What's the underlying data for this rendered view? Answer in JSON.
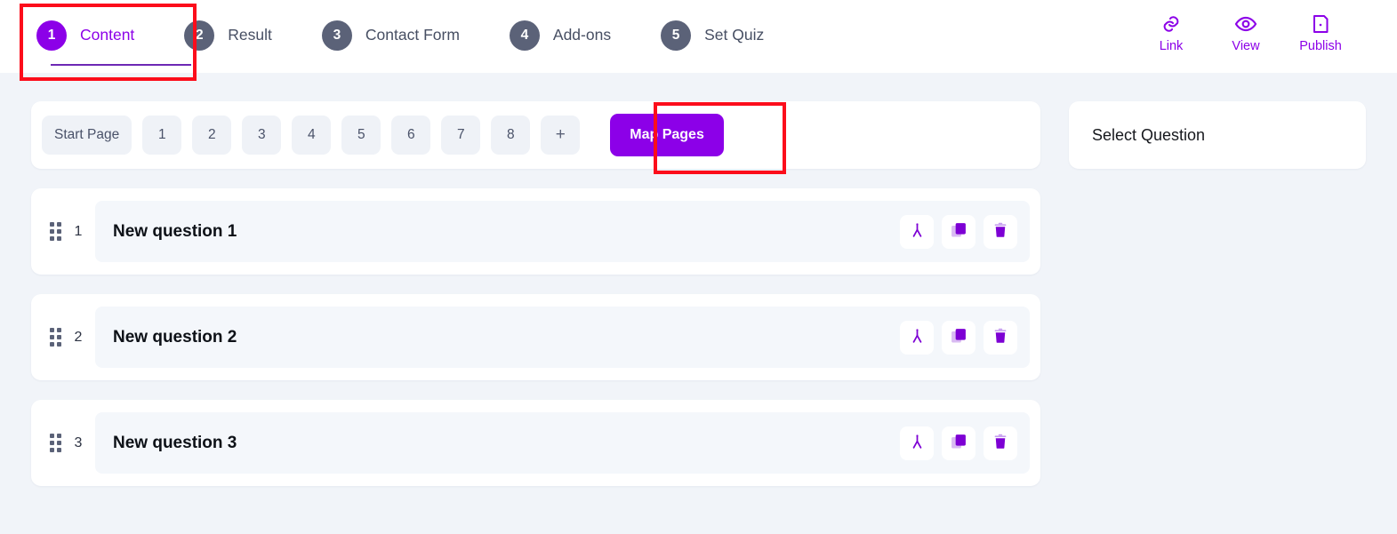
{
  "header": {
    "steps": [
      {
        "num": "1",
        "label": "Content",
        "active": true
      },
      {
        "num": "2",
        "label": "Result",
        "active": false
      },
      {
        "num": "3",
        "label": "Contact Form",
        "active": false
      },
      {
        "num": "4",
        "label": "Add-ons",
        "active": false
      },
      {
        "num": "5",
        "label": "Set Quiz",
        "active": false
      }
    ],
    "actions": [
      {
        "icon": "link-icon",
        "label": "Link"
      },
      {
        "icon": "eye-icon",
        "label": "View"
      },
      {
        "icon": "publish-icon",
        "label": "Publish"
      }
    ]
  },
  "pages_bar": {
    "chips": [
      "Start Page",
      "1",
      "2",
      "3",
      "4",
      "5",
      "6",
      "7",
      "8",
      "+"
    ],
    "map_pages_label": "Map Pages"
  },
  "questions": [
    {
      "index": "1",
      "title": "New question 1"
    },
    {
      "index": "2",
      "title": "New question 2"
    },
    {
      "index": "3",
      "title": "New question 3"
    }
  ],
  "question_actions": [
    {
      "icon": "logic-branch-icon",
      "name": "question-logic-button"
    },
    {
      "icon": "duplicate-icon",
      "name": "question-duplicate-button"
    },
    {
      "icon": "trash-icon",
      "name": "question-delete-button"
    }
  ],
  "right_panel": {
    "title": "Select Question"
  },
  "colors": {
    "accent_purple": "#8c00e8",
    "inactive_step": "#5b6278",
    "page_background": "#f1f4f9",
    "card_background": "#ffffff",
    "inner_panel": "#f4f7fb",
    "annotation_red": "#fc0d1b"
  }
}
